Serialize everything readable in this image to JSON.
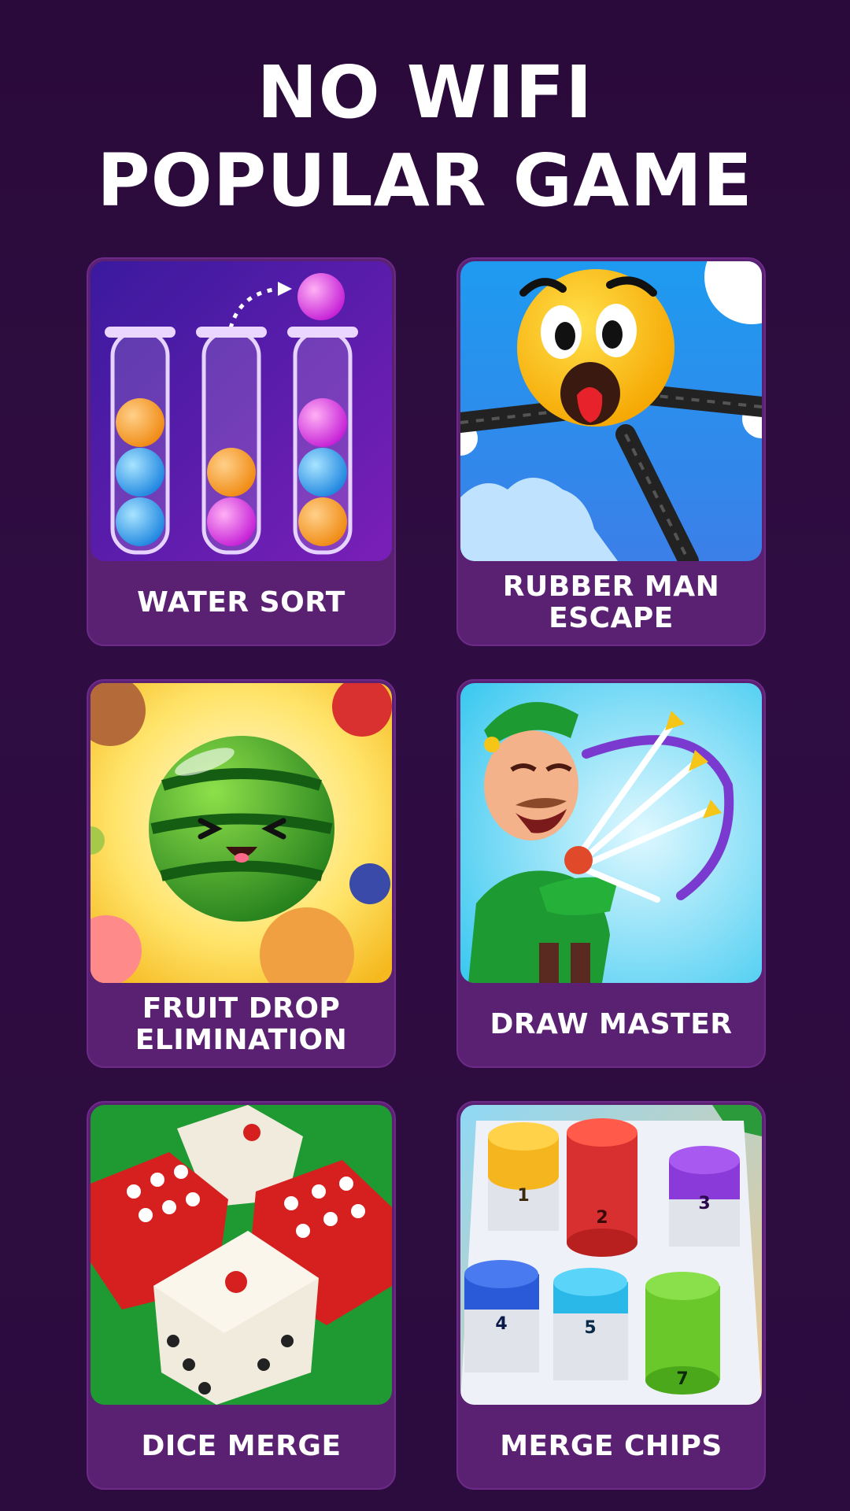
{
  "header": {
    "line1": "NO WIFI",
    "line2": "POPULAR GAME"
  },
  "games": [
    {
      "label": "WATER SORT",
      "icon": "water-sort-tubes-icon"
    },
    {
      "label": "RUBBER MAN\nESCAPE",
      "icon": "rubber-man-face-icon"
    },
    {
      "label": "FRUIT DROP\nELIMINATION",
      "icon": "watermelon-icon"
    },
    {
      "label": "DRAW MASTER",
      "icon": "archer-icon"
    },
    {
      "label": "DICE MERGE",
      "icon": "dice-icon"
    },
    {
      "label": "MERGE CHIPS",
      "icon": "chip-stacks-icon"
    }
  ],
  "chip_numbers": [
    "1",
    "2",
    "3",
    "4",
    "5",
    "7"
  ],
  "colors": {
    "background": "#2c0b3f",
    "card": "#5a2173",
    "text": "#ffffff"
  }
}
